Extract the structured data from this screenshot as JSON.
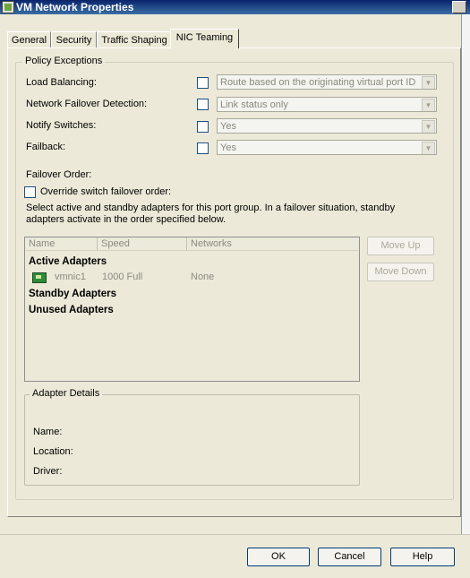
{
  "window": {
    "title": "VM Network Properties"
  },
  "tabs": [
    {
      "label": "General"
    },
    {
      "label": "Security"
    },
    {
      "label": "Traffic Shaping"
    },
    {
      "label": "NIC Teaming"
    }
  ],
  "policy_exceptions": {
    "title": "Policy Exceptions",
    "rows": [
      {
        "label": "Load Balancing:",
        "checked": false,
        "value": "Route based on the originating virtual port ID"
      },
      {
        "label": "Network Failover Detection:",
        "checked": false,
        "value": "Link status only"
      },
      {
        "label": "Notify Switches:",
        "checked": false,
        "value": "Yes"
      },
      {
        "label": "Failback:",
        "checked": false,
        "value": "Yes"
      }
    ],
    "failover_order_label": "Failover Order:",
    "override_label": "Override switch failover order:",
    "description": "Select active and standby adapters for this port group.  In a failover situation, standby adapters activate  in the order specified below."
  },
  "adapters_list": {
    "columns": [
      "Name",
      "Speed",
      "Networks"
    ],
    "active_header": "Active Adapters",
    "active": [
      {
        "name": "vmnic1",
        "speed": "1000 Full",
        "networks": "None"
      }
    ],
    "standby_header": "Standby Adapters",
    "unused_header": "Unused Adapters"
  },
  "move_buttons": {
    "up": "Move Up",
    "down": "Move Down"
  },
  "adapter_details": {
    "title": "Adapter Details",
    "name_label": "Name:",
    "location_label": "Location:",
    "driver_label": "Driver:"
  },
  "footer": {
    "ok": "OK",
    "cancel": "Cancel",
    "help": "Help"
  }
}
